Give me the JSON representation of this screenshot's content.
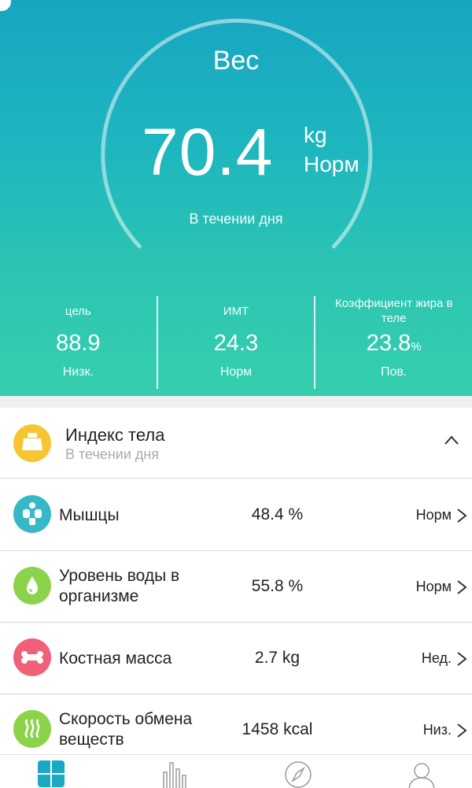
{
  "weight": {
    "title": "Вес",
    "value": "70.4",
    "unit": "kg",
    "status": "Норм",
    "period": "В течении дня"
  },
  "stats": [
    {
      "label": "цель",
      "value": "88.9",
      "suffix": "",
      "status": "Низк."
    },
    {
      "label": "ИМТ",
      "value": "24.3",
      "suffix": "",
      "status": "Норм"
    },
    {
      "label": "Коэффициент жира в теле",
      "value": "23.8",
      "suffix": "%",
      "status": "Пов."
    }
  ],
  "section": {
    "title": "Индекс тела",
    "subtitle": "В течении дня"
  },
  "rows": [
    {
      "label": "Мышцы",
      "value": "48.4 %",
      "status": "Норм",
      "icon": "muscle-icon",
      "color": "#37b8c8"
    },
    {
      "label": "Уровень воды в организме",
      "value": "55.8 %",
      "status": "Норм",
      "icon": "water-drop-icon",
      "color": "#8bd34a"
    },
    {
      "label": "Костная масса",
      "value": "2.7 kg",
      "status": "Нед.",
      "icon": "bone-icon",
      "color": "#f06078"
    },
    {
      "label": "Скорость обмена веществ",
      "value": "1458 kcal",
      "status": "Низ.",
      "icon": "metabolism-icon",
      "color": "#8bd34a"
    }
  ],
  "tabs": [
    {
      "icon": "dashboard-icon",
      "active": true
    },
    {
      "icon": "stats-icon",
      "active": false
    },
    {
      "icon": "compass-icon",
      "active": false
    },
    {
      "icon": "profile-icon",
      "active": false
    }
  ],
  "colors": {
    "accent": "#1aa8c2",
    "section_icon": "#f7c531",
    "inactive_tab": "#9a9a9a"
  }
}
